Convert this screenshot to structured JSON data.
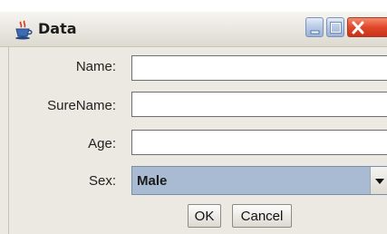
{
  "window": {
    "title": "Data",
    "icon": "java-cup-icon",
    "controls": {
      "minimize": "minimize-icon",
      "maximize": "maximize-icon",
      "close": "close-icon"
    }
  },
  "form": {
    "name": {
      "label": "Name:",
      "value": ""
    },
    "surename": {
      "label": "SureName:",
      "value": ""
    },
    "age": {
      "label": "Age:",
      "value": ""
    },
    "sex": {
      "label": "Sex:",
      "selected": "Male",
      "arrow_icon": "dropdown-arrow-icon"
    }
  },
  "buttons": {
    "ok": "OK",
    "cancel": "Cancel"
  },
  "colors": {
    "window_bg": "#ece9e2",
    "select_bg": "#a8bbd3",
    "close_red": "#e0482a",
    "control_blue": "#b7c9e6"
  }
}
